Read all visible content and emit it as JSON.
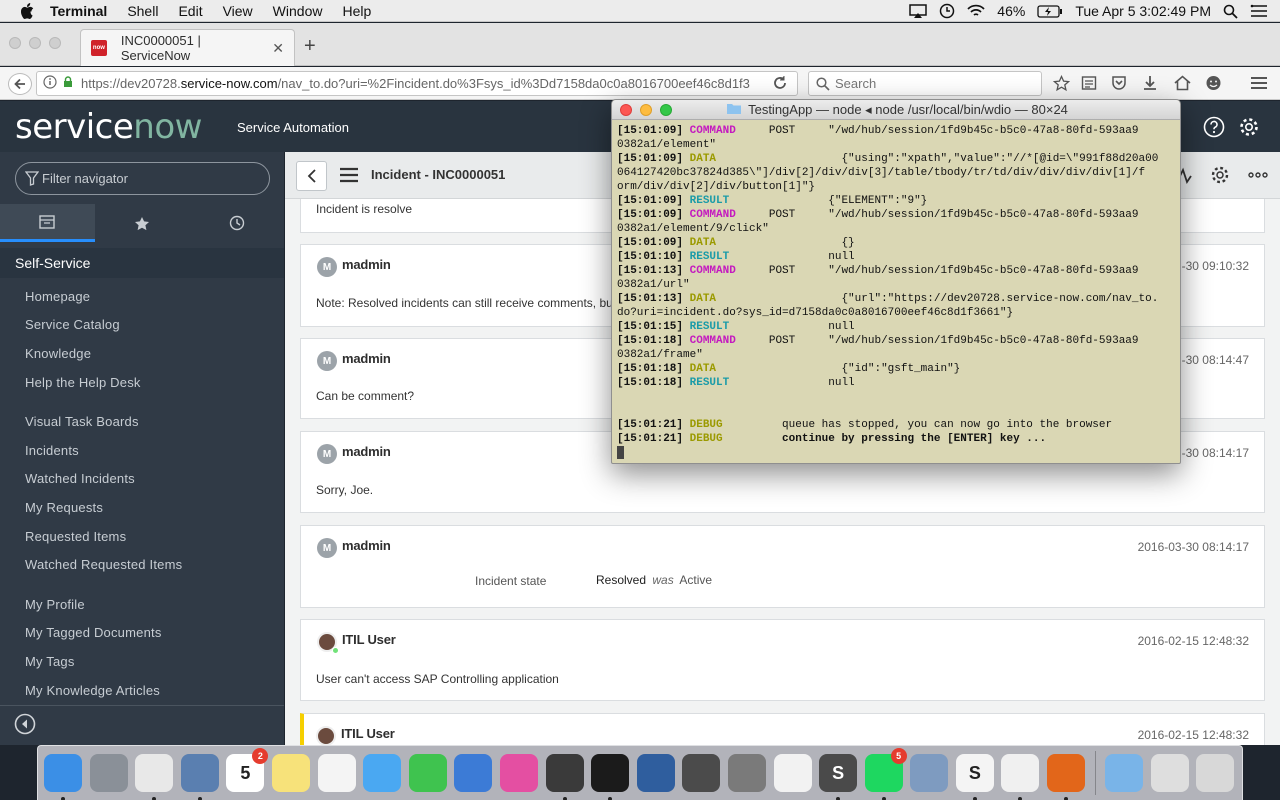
{
  "menubar": {
    "app": "Terminal",
    "items": [
      "Shell",
      "Edit",
      "View",
      "Window",
      "Help"
    ],
    "battery": "46%",
    "clock": "Tue Apr 5  3:02:49 PM"
  },
  "browser": {
    "tab_title": "INC0000051 | ServiceNow",
    "url_prefix": "https://dev20728.",
    "url_host": "service-now.com",
    "url_rest": "/nav_to.do?uri=%2Fincident.do%3Fsys_id%3Dd7158da0c0a8016700eef46c8d1f3",
    "search_placeholder": "Search"
  },
  "servicenow": {
    "logo_service": "service",
    "logo_now": "now",
    "subtitle": "Service Automation"
  },
  "sidebar": {
    "filter_placeholder": "Filter navigator",
    "section": "Self-Service",
    "group1": [
      "Homepage",
      "Service Catalog",
      "Knowledge",
      "Help the Help Desk"
    ],
    "group2": [
      "Visual Task Boards",
      "Incidents",
      "Watched Incidents",
      "My Requests",
      "Requested Items",
      "Watched Requested Items"
    ],
    "group3": [
      "My Profile",
      "My Tagged Documents",
      "My Tags",
      "My Knowledge Articles"
    ]
  },
  "content": {
    "title": "Incident - INC0000051",
    "partial_text": "Incident is resolve",
    "entries": [
      {
        "initial": "M",
        "author": "madmin",
        "date": "03-30 09:10:32",
        "body": "Note: Resolved incidents can still receive comments, bu"
      },
      {
        "initial": "M",
        "author": "madmin",
        "date": "03-30 08:14:47",
        "body": "Can be comment?"
      },
      {
        "initial": "M",
        "author": "madmin",
        "date": "03-30 08:14:17",
        "body": "Sorry, Joe."
      },
      {
        "initial": "M",
        "author": "madmin",
        "date": "2016-03-30 08:14:17",
        "field": "Incident state",
        "new_value": "Resolved",
        "was_label": "was",
        "old_value": "Active"
      },
      {
        "author": "ITIL User",
        "date": "2016-02-15 12:48:32",
        "body": "User can't access SAP Controlling application"
      },
      {
        "author": "ITIL User",
        "date": "2016-02-15 12:48:32"
      }
    ]
  },
  "terminal": {
    "title": "TestingApp — node ◂ node /usr/local/bin/wdio — 80×24",
    "lines": [
      {
        "ts": "[15:01:09]",
        "kind": "COMMAND",
        "text": "     POST     \"/wd/hub/session/1fd9b45c-b5c0-47a8-80fd-593aa9"
      },
      {
        "ts": "",
        "kind": "",
        "text": "0382a1/element\""
      },
      {
        "ts": "[15:01:09]",
        "kind": "DATA",
        "text": "                {\"using\":\"xpath\",\"value\":\"//*[@id=\\\"991f88d20a00"
      },
      {
        "ts": "",
        "kind": "",
        "text": "064127420bc37824d385\\\"]/div[2]/div/div[3]/table/tbody/tr/td/div/div/div/div[1]/f"
      },
      {
        "ts": "",
        "kind": "",
        "text": "orm/div/div[2]/div/button[1]\"}"
      },
      {
        "ts": "[15:01:09]",
        "kind": "RESULT",
        "text": "              {\"ELEMENT\":\"9\"}"
      },
      {
        "ts": "[15:01:09]",
        "kind": "COMMAND",
        "text": "     POST     \"/wd/hub/session/1fd9b45c-b5c0-47a8-80fd-593aa9"
      },
      {
        "ts": "",
        "kind": "",
        "text": "0382a1/element/9/click\""
      },
      {
        "ts": "[15:01:09]",
        "kind": "DATA",
        "text": "                {}"
      },
      {
        "ts": "[15:01:10]",
        "kind": "RESULT",
        "text": "              null"
      },
      {
        "ts": "[15:01:13]",
        "kind": "COMMAND",
        "text": "     POST     \"/wd/hub/session/1fd9b45c-b5c0-47a8-80fd-593aa9"
      },
      {
        "ts": "",
        "kind": "",
        "text": "0382a1/url\""
      },
      {
        "ts": "[15:01:13]",
        "kind": "DATA",
        "text": "                {\"url\":\"https://dev20728.service-now.com/nav_to."
      },
      {
        "ts": "",
        "kind": "",
        "text": "do?uri=incident.do?sys_id=d7158da0c0a8016700eef46c8d1f3661\"}"
      },
      {
        "ts": "[15:01:15]",
        "kind": "RESULT",
        "text": "              null"
      },
      {
        "ts": "[15:01:18]",
        "kind": "COMMAND",
        "text": "     POST     \"/wd/hub/session/1fd9b45c-b5c0-47a8-80fd-593aa9"
      },
      {
        "ts": "",
        "kind": "",
        "text": "0382a1/frame\""
      },
      {
        "ts": "[15:01:18]",
        "kind": "DATA",
        "text": "                {\"id\":\"gsft_main\"}"
      },
      {
        "ts": "[15:01:18]",
        "kind": "RESULT",
        "text": "              null"
      },
      {
        "ts": "",
        "kind": "",
        "text": ""
      },
      {
        "ts": "",
        "kind": "",
        "text": ""
      },
      {
        "ts": "[15:01:21]",
        "kind": "DEBUG",
        "text": "       queue has stopped, you can now go into the browser"
      },
      {
        "ts": "[15:01:21]",
        "kind": "DEBUG",
        "text": "       continue by pressing the [ENTER] key ...",
        "bold": true
      }
    ]
  },
  "dock": {
    "apps": [
      {
        "name": "Finder",
        "color": "#3b8fe6",
        "running": true
      },
      {
        "name": "Launchpad",
        "color": "#8a9098",
        "running": false
      },
      {
        "name": "Chrome",
        "color": "#e8e8e8",
        "running": true
      },
      {
        "name": "Preview",
        "color": "#5a7fb0",
        "running": true
      },
      {
        "name": "Calendar",
        "color": "#ffffff",
        "badge": "2",
        "label": "5",
        "running": false
      },
      {
        "name": "Notes",
        "color": "#f7e27a",
        "running": false
      },
      {
        "name": "Reminders",
        "color": "#f4f4f4",
        "running": false
      },
      {
        "name": "Messages",
        "color": "#4aa8f2",
        "running": false
      },
      {
        "name": "FaceTime",
        "color": "#3fc34f",
        "running": false
      },
      {
        "name": "Keynote",
        "color": "#3c7bd6",
        "running": false
      },
      {
        "name": "iTunes",
        "color": "#e44fa2",
        "running": false
      },
      {
        "name": "Sequel",
        "color": "#3a3a3a",
        "running": true
      },
      {
        "name": "Terminal",
        "color": "#1b1b1b",
        "running": true
      },
      {
        "name": "VirtualBox",
        "color": "#2f5e9e",
        "running": false
      },
      {
        "name": "Screen",
        "color": "#4b4b4b",
        "running": false
      },
      {
        "name": "System Preferences",
        "color": "#7a7a7a",
        "running": false
      },
      {
        "name": "TextEdit",
        "color": "#f2f2f2",
        "running": false
      },
      {
        "name": "Sublime Text",
        "color": "#4a4a4a",
        "label": "S",
        "running": true
      },
      {
        "name": "Spotify",
        "color": "#1ed760",
        "badge": "5",
        "running": true
      },
      {
        "name": "Image Capture",
        "color": "#7e9bc0",
        "running": false
      },
      {
        "name": "Slack",
        "color": "#f4f4f4",
        "label": "S",
        "running": true
      },
      {
        "name": "Java",
        "color": "#f0f0f0",
        "running": true
      },
      {
        "name": "Firefox",
        "color": "#e2661a",
        "running": true
      }
    ],
    "right": [
      {
        "name": "Applications",
        "color": "#79b4e8"
      },
      {
        "name": "Downloads",
        "color": "#dedede"
      },
      {
        "name": "Trash",
        "color": "#d8d8d8"
      }
    ]
  },
  "colors": {
    "sn_header": "#29343f",
    "sidebar": "#303a46",
    "terminal_bg": "#dad7b4",
    "accent_blue": "#278efc"
  }
}
